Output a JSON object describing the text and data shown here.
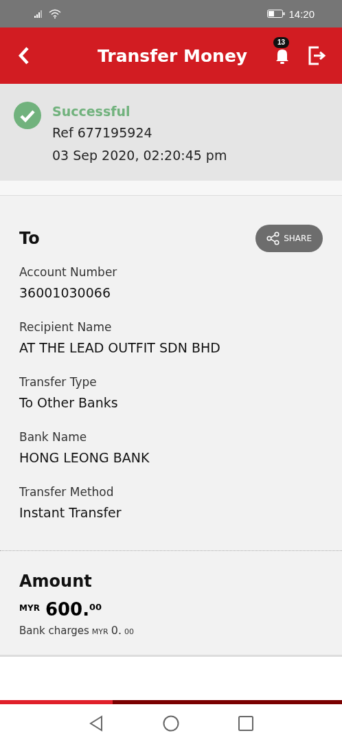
{
  "status_bar": {
    "time": "14:20"
  },
  "header": {
    "title": "Transfer Money",
    "notification_count": "13"
  },
  "result": {
    "status": "Successful",
    "reference": "Ref 677195924",
    "datetime": "03 Sep 2020, 02:20:45 pm"
  },
  "recipient": {
    "heading": "To",
    "share_label": "SHARE",
    "fields": [
      {
        "label": "Account Number",
        "value": "36001030066"
      },
      {
        "label": "Recipient Name",
        "value": "AT THE LEAD OUTFIT SDN BHD"
      },
      {
        "label": "Transfer Type",
        "value": "To Other Banks"
      },
      {
        "label": "Bank Name",
        "value": "HONG LEONG BANK"
      },
      {
        "label": "Transfer Method",
        "value": "Instant Transfer"
      }
    ]
  },
  "amount": {
    "heading": "Amount",
    "currency": "MYR",
    "whole": "600.",
    "decimals": "00",
    "charges_label": "Bank charges",
    "charges_currency": "MYR",
    "charges_whole": "0.",
    "charges_decimals": "00"
  },
  "progress": {
    "level": 0.33
  }
}
